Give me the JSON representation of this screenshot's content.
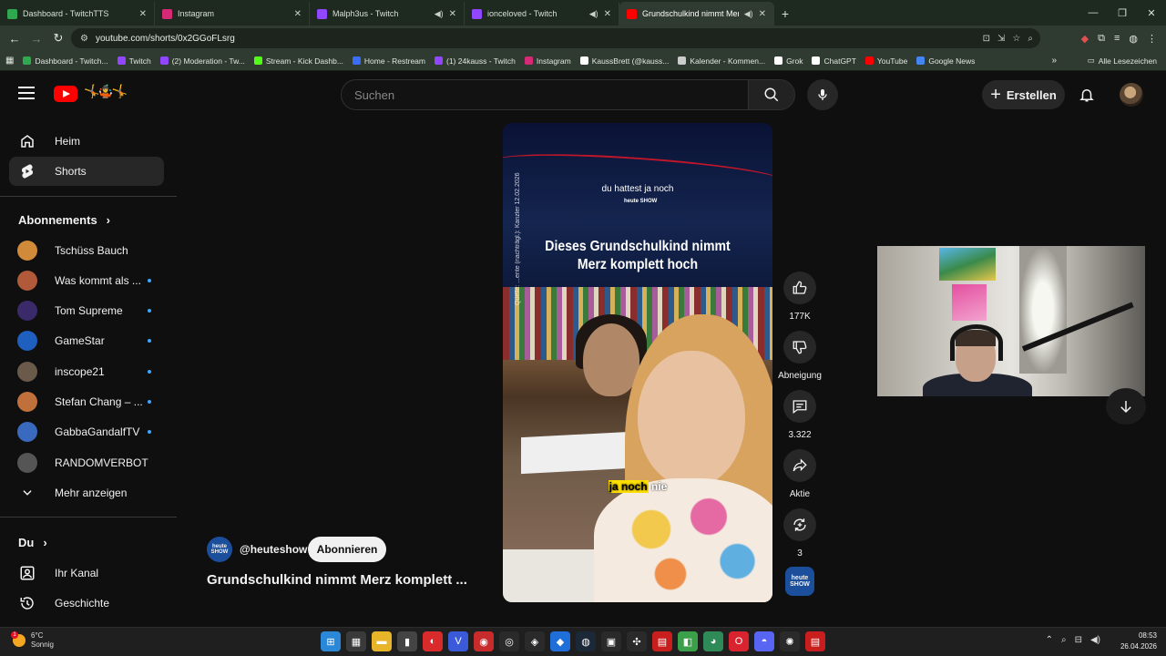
{
  "browser": {
    "tabs": [
      {
        "title": "Dashboard - TwitchTTS",
        "color": "#2fa84f",
        "active": false,
        "audio": false
      },
      {
        "title": "Instagram",
        "color": "#d62976",
        "active": false,
        "audio": false
      },
      {
        "title": "Malph3us - Twitch",
        "color": "#9146ff",
        "active": false,
        "audio": true
      },
      {
        "title": "ionceloved - Twitch",
        "color": "#9146ff",
        "active": false,
        "audio": true
      },
      {
        "title": "Grundschulkind nimmt Mer",
        "color": "#ff0000",
        "active": true,
        "audio": true
      }
    ],
    "new_tab": "+",
    "url": "youtube.com/shorts/0x2GGoFLsrg",
    "bookmarks": [
      {
        "label": "Dashboard - Twitch...",
        "color": "#2fa84f"
      },
      {
        "label": "Twitch",
        "color": "#9146ff"
      },
      {
        "label": "(2) Moderation - Tw...",
        "color": "#9146ff"
      },
      {
        "label": "Stream - Kick Dashb...",
        "color": "#53fc18"
      },
      {
        "label": "Home - Restream",
        "color": "#3b6cf6"
      },
      {
        "label": "(1) 24kauss - Twitch",
        "color": "#9146ff"
      },
      {
        "label": "Instagram",
        "color": "#d62976"
      },
      {
        "label": "KaussBrett (@kauss...",
        "color": "#ffffff"
      },
      {
        "label": "Kalender - Kommen...",
        "color": "#cccccc"
      },
      {
        "label": "Grok",
        "color": "#ffffff"
      },
      {
        "label": "ChatGPT",
        "color": "#ffffff"
      },
      {
        "label": "YouTube",
        "color": "#ff0000"
      },
      {
        "label": "Google News",
        "color": "#4285f4"
      }
    ],
    "bookmarks_more": "»",
    "all_bookmarks": "Alle Lesezeichen"
  },
  "youtube": {
    "search_placeholder": "Suchen",
    "create_label": "Erstellen",
    "sidebar": {
      "home": "Heim",
      "shorts": "Shorts",
      "subscriptions_heading": "Abonnements",
      "channels": [
        {
          "name": "Tschüss Bauch",
          "color": "#d08a3a",
          "new": false
        },
        {
          "name": "Was kommt als ...",
          "color": "#b05a3a",
          "new": true
        },
        {
          "name": "Tom Supreme",
          "color": "#3a2a6a",
          "new": true
        },
        {
          "name": "GameStar",
          "color": "#1f5fbf",
          "new": true
        },
        {
          "name": "inscope21",
          "color": "#6a5a4a",
          "new": true
        },
        {
          "name": "Stefan Chang – ...",
          "color": "#c0703a",
          "new": true
        },
        {
          "name": "GabbaGandalfTV",
          "color": "#3a6abf",
          "new": true
        },
        {
          "name": "RANDOMVERBOT",
          "color": "#555555",
          "new": false
        }
      ],
      "show_more": "Mehr anzeigen",
      "you_heading": "Du",
      "your_channel": "Ihr Kanal",
      "history": "Geschichte"
    },
    "short": {
      "subtitle_top": "du hattest ja noch",
      "logo_text": "heute SHOW",
      "caption": "Dieses Grundschulkind nimmt Merz komplett hoch",
      "side_text": "Quelle: ...ente (nachträgl.): Kanzler 12.02.2026",
      "subtitle_bottom_hl": "ja noch",
      "subtitle_bottom_rest": " nie",
      "channel_handle": "@heuteshow",
      "subscribe_label": "Abonnieren",
      "title": "Grundschulkind nimmt Merz komplett ..."
    },
    "actions": {
      "likes": "177K",
      "dislike": "Abneigung",
      "comments": "3.322",
      "share": "Aktie",
      "remix": "3"
    }
  },
  "taskbar": {
    "temp": "6°C",
    "weather": "Sonnig",
    "notif_count": "1",
    "time": "08:53",
    "date": "26.04.2026",
    "apps": [
      {
        "name": "windows",
        "color": "#2b88d8",
        "glyph": "⊞"
      },
      {
        "name": "calculator",
        "color": "#3a3a3a",
        "glyph": "▦"
      },
      {
        "name": "files",
        "color": "#e8b42a",
        "glyph": "▬"
      },
      {
        "name": "mouse",
        "color": "#444444",
        "glyph": "▮"
      },
      {
        "name": "red-app",
        "color": "#d92b2b",
        "glyph": "◐"
      },
      {
        "name": "v-app",
        "color": "#3a5ad9",
        "glyph": "V"
      },
      {
        "name": "gpt",
        "color": "#c82b2b",
        "glyph": "◉"
      },
      {
        "name": "obs",
        "color": "#2a2a2a",
        "glyph": "◎"
      },
      {
        "name": "ea",
        "color": "#2a2a2a",
        "glyph": "◈"
      },
      {
        "name": "blue-app",
        "color": "#1f6fd9",
        "glyph": "◆"
      },
      {
        "name": "steam",
        "color": "#1b2838",
        "glyph": "◍"
      },
      {
        "name": "epic",
        "color": "#2a2a2a",
        "glyph": "▣"
      },
      {
        "name": "grid-app",
        "color": "#2a2a2a",
        "glyph": "✣"
      },
      {
        "name": "elgato",
        "color": "#c81e1e",
        "glyph": "▤"
      },
      {
        "name": "layers",
        "color": "#3aa04a",
        "glyph": "◧"
      },
      {
        "name": "chrome",
        "color": "#2e8b57",
        "glyph": "◕"
      },
      {
        "name": "opera",
        "color": "#d9232e",
        "glyph": "O"
      },
      {
        "name": "discord",
        "color": "#5865f2",
        "glyph": "◓"
      },
      {
        "name": "chatgpt",
        "color": "#2a2a2a",
        "glyph": "✺"
      },
      {
        "name": "streamdeck",
        "color": "#c81e1e",
        "glyph": "▤"
      }
    ],
    "tray": [
      "⌃",
      "⌕",
      "⊟",
      "🔊"
    ]
  }
}
